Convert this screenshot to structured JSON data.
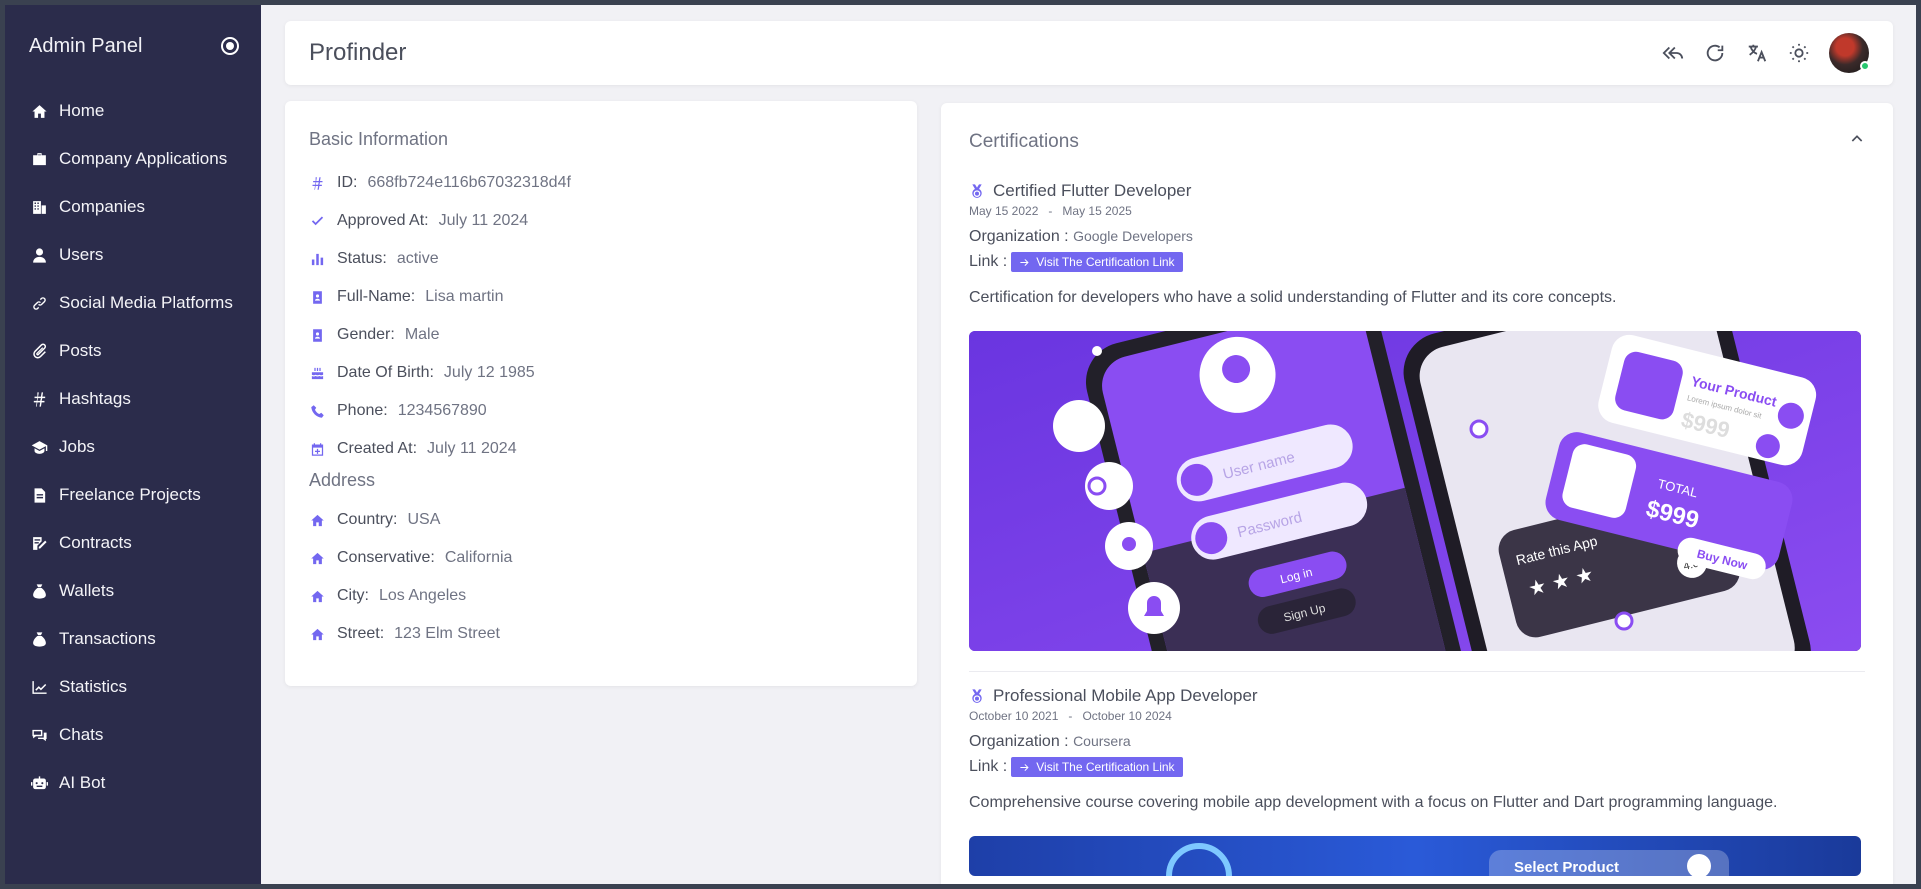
{
  "sidebar": {
    "title": "Admin Panel",
    "items": [
      {
        "label": "Home",
        "icon": "home-icon"
      },
      {
        "label": "Company Applications",
        "icon": "briefcase-icon"
      },
      {
        "label": "Companies",
        "icon": "building-icon"
      },
      {
        "label": "Users",
        "icon": "user-icon"
      },
      {
        "label": "Social Media Platforms",
        "icon": "link-icon"
      },
      {
        "label": "Posts",
        "icon": "paperclip-icon"
      },
      {
        "label": "Hashtags",
        "icon": "hash-icon"
      },
      {
        "label": "Jobs",
        "icon": "graduation-cap-icon"
      },
      {
        "label": "Freelance Projects",
        "icon": "document-icon"
      },
      {
        "label": "Contracts",
        "icon": "contract-icon"
      },
      {
        "label": "Wallets",
        "icon": "money-bag-icon"
      },
      {
        "label": "Transactions",
        "icon": "wallet-icon"
      },
      {
        "label": "Statistics",
        "icon": "chart-line-icon"
      },
      {
        "label": "Chats",
        "icon": "chat-icon"
      },
      {
        "label": "AI Bot",
        "icon": "robot-icon"
      }
    ]
  },
  "topbar": {
    "title": "Profinder",
    "actions": [
      "reply-all-icon",
      "refresh-icon",
      "translate-icon",
      "sun-icon"
    ]
  },
  "basic_info": {
    "title": "Basic Information",
    "rows": [
      {
        "label": "ID:",
        "value": "668fb724e116b67032318d4f",
        "icon": "hash-icon"
      },
      {
        "label": "Approved At:",
        "value": "July 11 2024",
        "icon": "check-icon"
      },
      {
        "label": "Status:",
        "value": "active",
        "icon": "bar-chart-icon"
      },
      {
        "label": "Full-Name:",
        "value": "Lisa martin",
        "icon": "id-badge-icon"
      },
      {
        "label": "Gender:",
        "value": "Male",
        "icon": "id-badge-icon"
      },
      {
        "label": "Date Of Birth:",
        "value": "July 12 1985",
        "icon": "cake-icon"
      },
      {
        "label": "Phone:",
        "value": "1234567890",
        "icon": "phone-icon"
      },
      {
        "label": "Created At:",
        "value": "July 11 2024",
        "icon": "calendar-icon"
      }
    ]
  },
  "address": {
    "title": "Address",
    "rows": [
      {
        "label": "Country:",
        "value": "USA",
        "icon": "home-icon"
      },
      {
        "label": "Conservative:",
        "value": "California",
        "icon": "home-icon"
      },
      {
        "label": "City:",
        "value": "Los Angeles",
        "icon": "home-icon"
      },
      {
        "label": "Street:",
        "value": "123 Elm Street",
        "icon": "home-icon"
      }
    ]
  },
  "certifications": {
    "title": "Certifications",
    "items": [
      {
        "name": "Certified Flutter Developer",
        "start": "May 15 2022",
        "sep": "-",
        "end": "May 15 2025",
        "org_label": "Organization :",
        "org": "Google Developers",
        "link_label": "Link :",
        "link_text": "Visit The Certification Link",
        "description": "Certification for developers who have a solid understanding of Flutter and its core concepts."
      },
      {
        "name": "Professional Mobile App Developer",
        "start": "October 10 2021",
        "sep": "-",
        "end": "October 10 2024",
        "org_label": "Organization :",
        "org": "Coursera",
        "link_label": "Link :",
        "link_text": "Visit The Certification Link",
        "description": "Comprehensive course covering mobile app development with a focus on Flutter and Dart programming language."
      }
    ],
    "image_text": {
      "user_name": "User name",
      "password": "Password",
      "login": "Log in",
      "signup": "Sign Up",
      "your_product": "Your Product",
      "lorem": "Lorem ipsum dolor sit",
      "price": "$999",
      "total": "TOTAL",
      "total_price": "$999",
      "buy_now": "Buy Now",
      "rate": "Rate this App",
      "rating": "4.0",
      "select_product": "Select Product"
    }
  },
  "colors": {
    "sidebar_bg": "#2b2c4b",
    "accent": "#7367f0",
    "page_bg": "#f1f1f5"
  }
}
